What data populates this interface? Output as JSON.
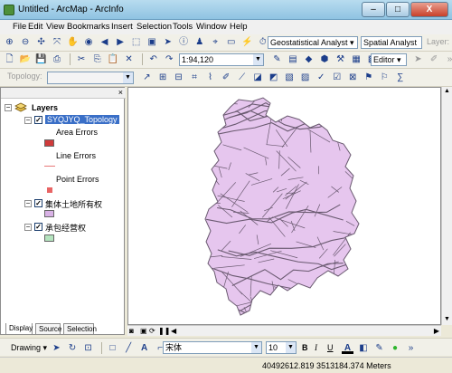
{
  "window": {
    "title": "Untitled - ArcMap - ArcInfo",
    "minimize": "–",
    "maximize": "□",
    "close": "X"
  },
  "menu": [
    "File",
    "Edit",
    "View",
    "Bookmarks",
    "Insert",
    "Selection",
    "Tools",
    "Window",
    "Help"
  ],
  "toolbar1": {
    "geostatistical": "Geostatistical Analyst ▾",
    "spatial": "Spatial Analyst ▾",
    "layer_label": "Layer:"
  },
  "toolbar2": {
    "scale": "1:94,120",
    "editor": "Editor ▾"
  },
  "toolbar3": {
    "topology_label": "Topology:"
  },
  "toc": {
    "close": "×",
    "root": "Layers",
    "topology_layer": "SYQJYQ_Topology",
    "area_errors": "Area Errors",
    "line_errors": "Line Errors",
    "point_errors": "Point Errors",
    "layer2": "集体土地所有权",
    "layer3": "承包经营权",
    "tabs": [
      "Display",
      "Source",
      "Selection"
    ]
  },
  "colors": {
    "map_fill": "#e6c6ee",
    "map_line": "#6a5a70",
    "area_error": "#d03a3a",
    "line_error": "#e87878",
    "point_error": "#e86464",
    "layer2_fill": "#d9b2e6",
    "layer3_fill": "#b5e4bf"
  },
  "drawing": {
    "drawing_label": "Drawing ▾",
    "font": "宋体",
    "font_size": "10",
    "bold": "B",
    "italic": "I",
    "underline": "U"
  },
  "status": {
    "coords": "40492612.819  3513184.374 Meters"
  }
}
